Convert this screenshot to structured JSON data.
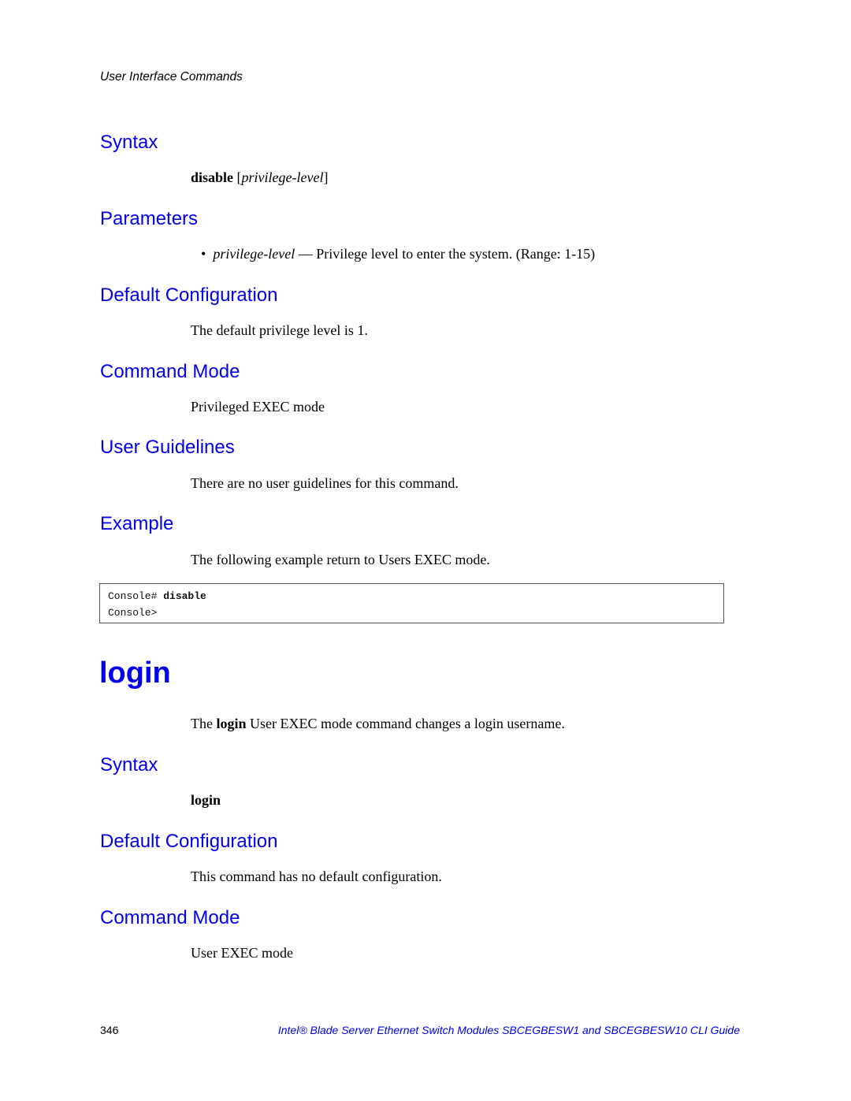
{
  "running_head": "User Interface Commands",
  "disable_section": {
    "syntax_heading": "Syntax",
    "syntax_command": "disable",
    "syntax_open": " [",
    "syntax_param": "privilege-level",
    "syntax_close": "]",
    "parameters_heading": "Parameters",
    "param_bullet": "•",
    "param_name": "privilege-level",
    "param_desc": " — Privilege level to enter the system. (Range: 1-15)",
    "default_config_heading": "Default Configuration",
    "default_config_text": "The default privilege level is 1.",
    "command_mode_heading": "Command Mode",
    "command_mode_text": "Privileged EXEC mode",
    "user_guidelines_heading": "User Guidelines",
    "user_guidelines_text": "There are no user guidelines for this command.",
    "example_heading": "Example",
    "example_text": "The following example return to Users EXEC mode.",
    "code": {
      "line1_prompt": "Console# ",
      "line1_command": "disable",
      "line2": "Console>"
    }
  },
  "login_section": {
    "title": "login",
    "desc_pre": "The ",
    "desc_bold": "login",
    "desc_post": " User EXEC mode command changes a login username.",
    "syntax_heading": "Syntax",
    "syntax_command": "login",
    "default_config_heading": "Default Configuration",
    "default_config_text": "This command has no default configuration.",
    "command_mode_heading": "Command Mode",
    "command_mode_text": "User EXEC mode"
  },
  "footer": {
    "page_number": "346",
    "doc_title": "Intel® Blade Server Ethernet Switch Modules SBCEGBESW1 and SBCEGBESW10 CLI Guide"
  }
}
